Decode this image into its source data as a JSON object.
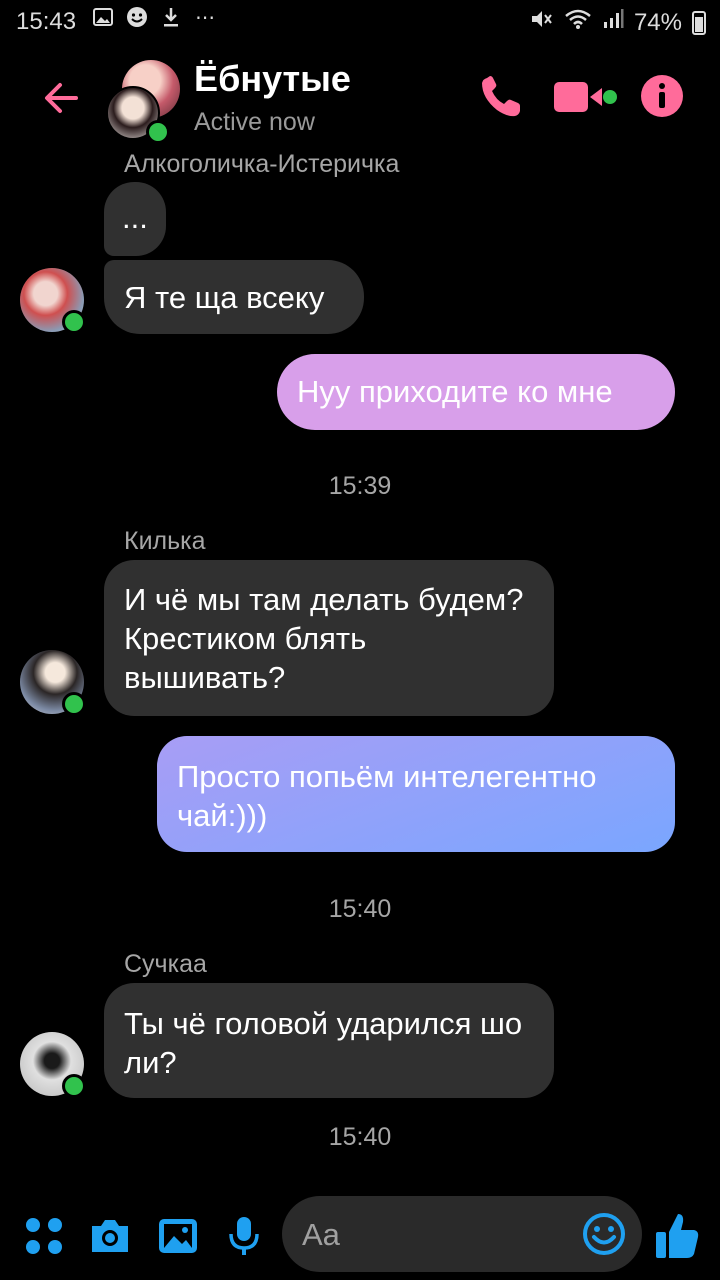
{
  "status_bar": {
    "time": "15:43",
    "battery": "74%",
    "left_icons": [
      "gallery-icon",
      "emoji-icon",
      "download-icon",
      "more-dots-icon"
    ],
    "right_icons": [
      "mute-icon",
      "wifi-icon",
      "signal-icon",
      "battery-icon"
    ],
    "more_glyph": "⋯"
  },
  "header": {
    "title": "Ёбнутые",
    "status": "Active now",
    "accent_color": "#ff6b9a",
    "online_color": "#31c24d"
  },
  "messages": [
    {
      "type": "sender",
      "text": "Алкоголичка-Истеричка"
    },
    {
      "type": "incoming",
      "text": "..."
    },
    {
      "type": "incoming",
      "text": "Я те ща всеку"
    },
    {
      "type": "outgoing",
      "text": "Нуу приходите ко мне"
    },
    {
      "type": "timestamp",
      "text": "15:39"
    },
    {
      "type": "sender",
      "text": "Килька"
    },
    {
      "type": "incoming",
      "text": "И чё мы там делать будем? Крестиком блять вышивать?"
    },
    {
      "type": "outgoing",
      "text": "Просто попьём интелегентно чай:)))"
    },
    {
      "type": "timestamp",
      "text": "15:40"
    },
    {
      "type": "sender",
      "text": "Сучкаа"
    },
    {
      "type": "incoming",
      "text": "Ты чё головой ударился шо ли?"
    },
    {
      "type": "timestamp",
      "text": "15:40"
    }
  ],
  "composer": {
    "placeholder": "Aa"
  },
  "colors": {
    "background": "#000000",
    "incoming_bubble": "#303030",
    "outgoing_gradient_pink": "#e59ae6",
    "outgoing_gradient_blue": "#7aa6ff",
    "toolbar_icons": "#1fa0f0"
  }
}
